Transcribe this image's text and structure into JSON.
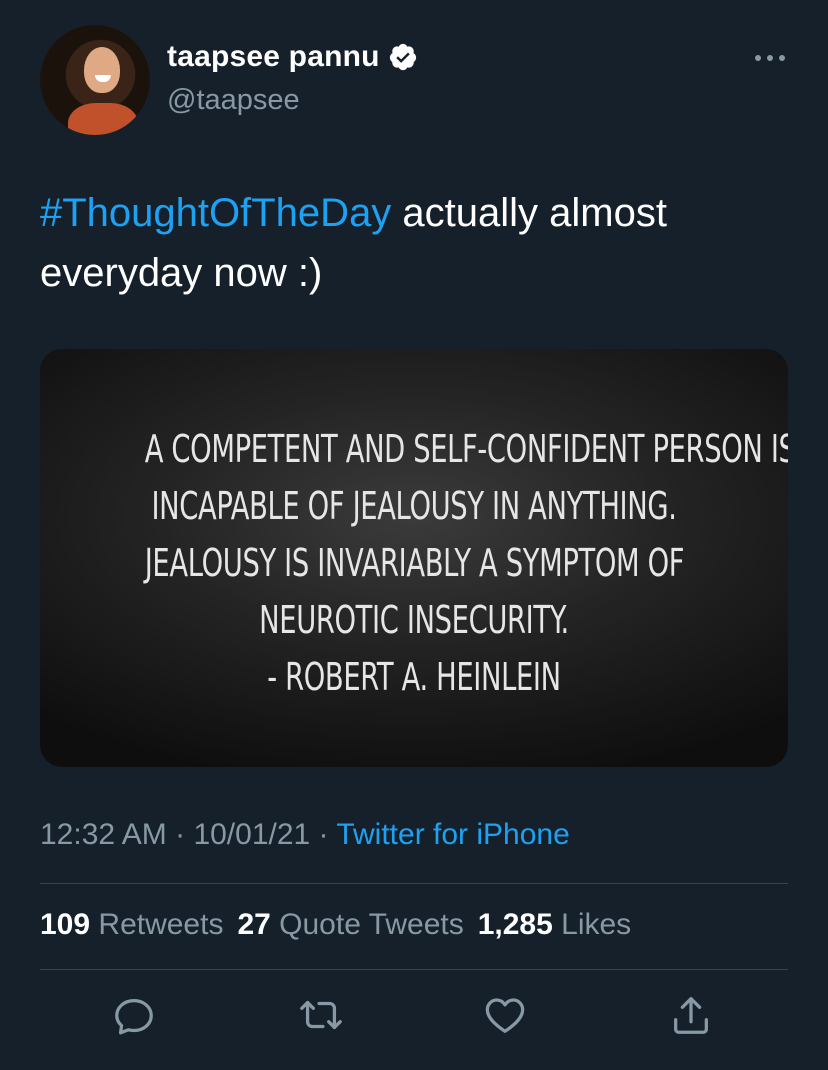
{
  "author": {
    "display_name": "taapsee pannu",
    "handle": "@taapsee",
    "verified": true
  },
  "tweet": {
    "hashtag": "#ThoughtOfTheDay",
    "text_line1": " actually almost",
    "text_line2": "everyday now :)"
  },
  "media": {
    "quote_lines": [
      "A COMPETENT AND SELF-CONFIDENT PERSON IS",
      "INCAPABLE OF JEALOUSY IN ANYTHING.",
      "JEALOUSY IS INVARIABLY A SYMPTOM OF",
      "NEUROTIC INSECURITY.",
      "- ROBERT A. HEINLEIN"
    ]
  },
  "meta": {
    "time": "12:32 AM",
    "separator": " · ",
    "date": "10/01/21",
    "source": "Twitter for iPhone"
  },
  "stats": {
    "retweets_count": "109",
    "retweets_label": " Retweets",
    "quotes_count": "27",
    "quotes_label": " Quote Tweets",
    "likes_count": "1,285",
    "likes_label": " Likes"
  },
  "icons": [
    "reply-icon",
    "retweet-icon",
    "like-icon",
    "share-icon",
    "more-options-icon",
    "verified-badge-icon"
  ],
  "colors": {
    "background": "#15202b",
    "accent": "#1da1f2",
    "secondary_text": "#8899a6",
    "divider": "#38444d"
  }
}
